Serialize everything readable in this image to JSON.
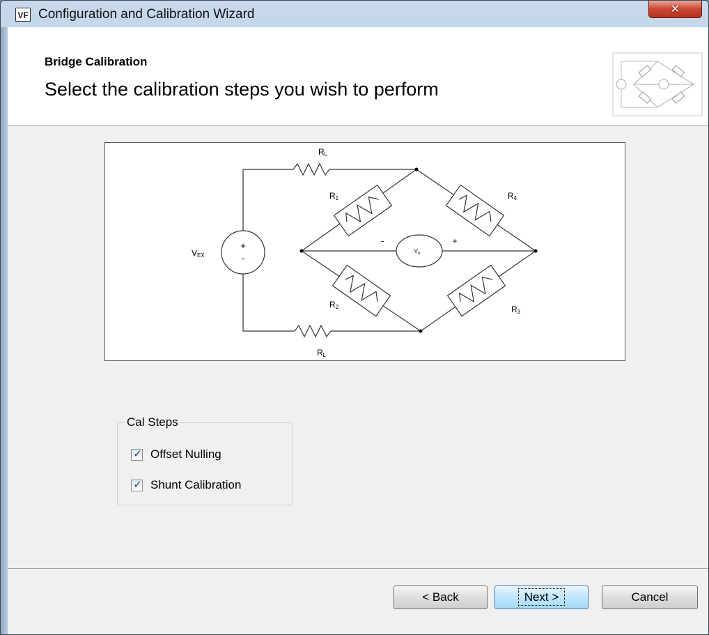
{
  "window": {
    "title": "Configuration and Calibration Wizard",
    "app_icon_text": "VF",
    "close_glyph": "✕"
  },
  "header": {
    "title": "Bridge Calibration",
    "subtitle": "Select the calibration steps you wish to perform"
  },
  "diagram": {
    "labels": {
      "rl_top": "R",
      "rl_top_sub": "L",
      "rl_bottom": "R",
      "rl_bottom_sub": "L",
      "r1": "R",
      "r1_sub": "1",
      "r2": "R",
      "r2_sub": "2",
      "r3": "R",
      "r3_sub": "3",
      "r4": "R",
      "r4_sub": "4",
      "vex": "V",
      "vex_sub": "EX",
      "vo": "V",
      "vo_sub": "o",
      "source_plus": "+",
      "source_minus": "-",
      "meter_minus": "-",
      "meter_plus": "+"
    }
  },
  "cal_steps": {
    "group_label": "Cal Steps",
    "items": [
      {
        "label": "Offset Nulling",
        "checked": true
      },
      {
        "label": "Shunt Calibration",
        "checked": true
      }
    ],
    "check_glyph": "✓"
  },
  "footer": {
    "back_label": "< Back",
    "next_label": "Next >",
    "cancel_label": "Cancel"
  },
  "colors": {
    "close_button": "#c94733",
    "default_button_border": "#3c7fb1",
    "check_mark": "#243c72"
  }
}
